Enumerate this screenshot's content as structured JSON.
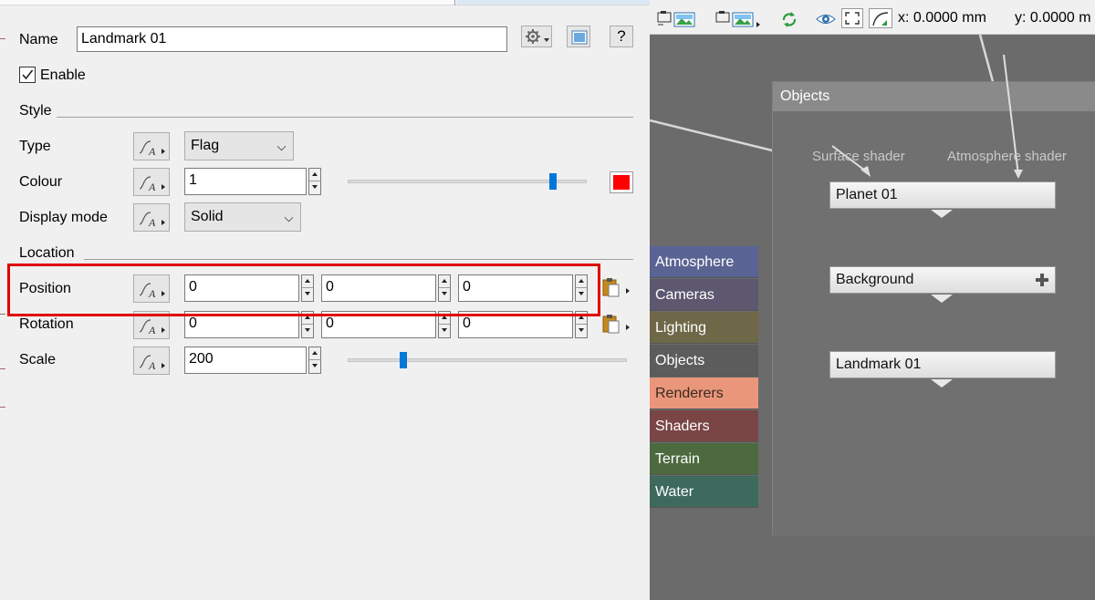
{
  "properties": {
    "name_label": "Name",
    "name_value": "Landmark 01",
    "enable_label": "Enable",
    "enable_checked": true,
    "style_section": "Style",
    "type_label": "Type",
    "type_value": "Flag",
    "colour_label": "Colour",
    "colour_value": "1",
    "colour_swatch": "#ff0000",
    "colour_slider_fraction": 0.86,
    "display_mode_label": "Display mode",
    "display_mode_value": "Solid",
    "location_section": "Location",
    "position_label": "Position",
    "position_x": "0",
    "position_y": "0",
    "position_z": "0",
    "rotation_label": "Rotation",
    "rotation_x": "0",
    "rotation_y": "0",
    "rotation_z": "0",
    "scale_label": "Scale",
    "scale_value": "200",
    "scale_slider_fraction": 0.2,
    "help_label": "?"
  },
  "toolbar": {
    "x_readout": "x: 0.0000 mm",
    "y_readout": "y: 0.0000 m"
  },
  "graph": {
    "panel_title": "Objects",
    "surface_shader_label": "Surface shader",
    "atmosphere_shader_label": "Atmosphere shader",
    "nodes": [
      "Planet 01",
      "Background",
      "Landmark 01"
    ],
    "categories": [
      {
        "label": "Atmosphere",
        "color": "#5a6493"
      },
      {
        "label": "Cameras",
        "color": "#5d5870"
      },
      {
        "label": "Lighting",
        "color": "#6f6848"
      },
      {
        "label": "Objects",
        "color": "#5c5c5c"
      },
      {
        "label": "Renderers",
        "color": "#e9967a"
      },
      {
        "label": "Shaders",
        "color": "#7a4545"
      },
      {
        "label": "Terrain",
        "color": "#4d6a3f"
      },
      {
        "label": "Water",
        "color": "#3e6a5e"
      }
    ]
  },
  "highlight_color": "#e00000"
}
